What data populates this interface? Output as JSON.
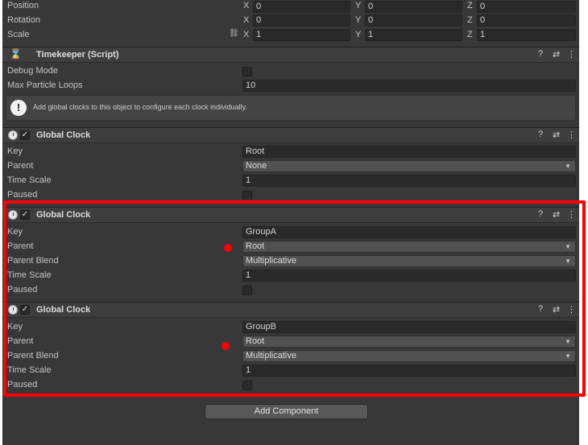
{
  "transform": {
    "rows": [
      {
        "label": "Position",
        "x": "0",
        "y": "0",
        "z": "0"
      },
      {
        "label": "Rotation",
        "x": "0",
        "y": "0",
        "z": "0"
      },
      {
        "label": "Scale",
        "x": "1",
        "y": "1",
        "z": "1"
      }
    ],
    "axis_labels": {
      "x": "X",
      "y": "Y",
      "z": "Z"
    }
  },
  "timekeeper": {
    "title": "Timekeeper (Script)",
    "debug_mode_label": "Debug Mode",
    "max_loops_label": "Max Particle Loops",
    "max_loops_value": "10",
    "help_text": "Add global clocks to this object to configure each clock individually."
  },
  "clocks": [
    {
      "title": "Global Clock",
      "key_label": "Key",
      "key": "Root",
      "parent_label": "Parent",
      "parent": "None",
      "time_scale_label": "Time Scale",
      "time_scale": "1",
      "paused_label": "Paused"
    },
    {
      "title": "Global Clock",
      "key_label": "Key",
      "key": "GroupA",
      "parent_label": "Parent",
      "parent": "Root",
      "blend_label": "Parent Blend",
      "blend": "Multiplicative",
      "time_scale_label": "Time Scale",
      "time_scale": "1",
      "paused_label": "Paused"
    },
    {
      "title": "Global Clock",
      "key_label": "Key",
      "key": "GroupB",
      "parent_label": "Parent",
      "parent": "Root",
      "blend_label": "Parent Blend",
      "blend": "Multiplicative",
      "time_scale_label": "Time Scale",
      "time_scale": "1",
      "paused_label": "Paused"
    }
  ],
  "header_icons": {
    "help": "?",
    "presets": "⇄",
    "menu": "⋮",
    "check": "✓",
    "dropdown_arrow": "▼",
    "scale_link": "⛓"
  },
  "add_component_label": "Add Component",
  "colors": {
    "highlight": "#ff0000",
    "panel": "#383838"
  }
}
